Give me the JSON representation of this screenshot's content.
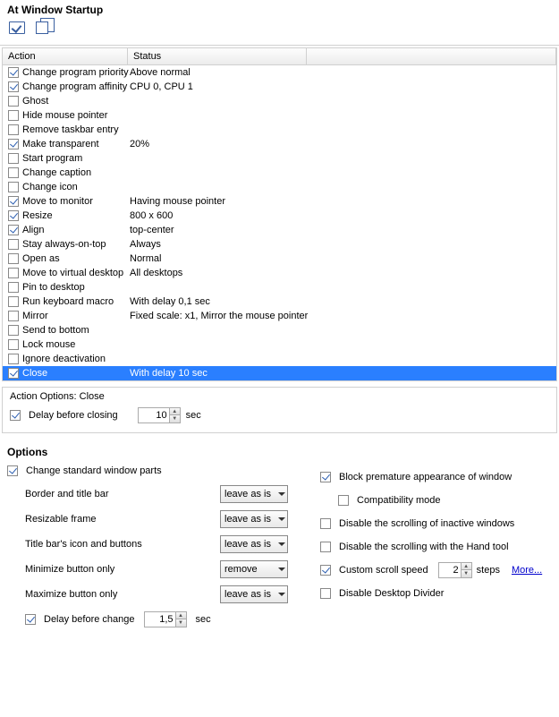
{
  "header": {
    "title": "At Window Startup"
  },
  "columns": {
    "action": "Action",
    "status": "Status"
  },
  "rows": [
    {
      "action": "Change program priority",
      "status": "Above normal",
      "checked": true
    },
    {
      "action": "Change program affinity",
      "status": "CPU 0, CPU 1",
      "checked": true
    },
    {
      "action": "Ghost",
      "status": "",
      "checked": false
    },
    {
      "action": "Hide mouse pointer",
      "status": "",
      "checked": false
    },
    {
      "action": "Remove taskbar entry",
      "status": "",
      "checked": false
    },
    {
      "action": "Make transparent",
      "status": "20%",
      "checked": true
    },
    {
      "action": "Start program",
      "status": "",
      "checked": false
    },
    {
      "action": "Change caption",
      "status": "",
      "checked": false
    },
    {
      "action": "Change icon",
      "status": "",
      "checked": false
    },
    {
      "action": "Move to monitor",
      "status": "Having mouse pointer",
      "checked": true
    },
    {
      "action": "Resize",
      "status": "800 x 600",
      "checked": true
    },
    {
      "action": "Align",
      "status": "top-center",
      "checked": true
    },
    {
      "action": "Stay always-on-top",
      "status": "Always",
      "checked": false
    },
    {
      "action": "Open as",
      "status": "Normal",
      "checked": false
    },
    {
      "action": "Move to virtual desktop",
      "status": "All desktops",
      "checked": false
    },
    {
      "action": "Pin to desktop",
      "status": "",
      "checked": false
    },
    {
      "action": "Run keyboard macro",
      "status": "With delay 0,1 sec",
      "checked": false
    },
    {
      "action": "Mirror",
      "status": "Fixed scale: x1, Mirror the mouse pointer",
      "checked": false
    },
    {
      "action": "Send to bottom",
      "status": "",
      "checked": false
    },
    {
      "action": "Lock mouse",
      "status": "",
      "checked": false
    },
    {
      "action": "Ignore deactivation",
      "status": "",
      "checked": false
    },
    {
      "action": "Close",
      "status": "With delay 10 sec",
      "checked": true,
      "selected": true
    }
  ],
  "action_options": {
    "title": "Action Options: Close",
    "delay_label": "Delay before closing",
    "delay_value": "10",
    "delay_unit": "sec"
  },
  "options": {
    "title": "Options",
    "change_parts": "Change standard window parts",
    "border_label": "Border and title bar",
    "border_val": "leave as is",
    "frame_label": "Resizable frame",
    "frame_val": "leave as is",
    "titlebar_label": "Title bar's icon and buttons",
    "titlebar_val": "leave as is",
    "min_label": "Minimize button only",
    "min_val": "remove",
    "max_label": "Maximize button only",
    "max_val": "leave as is",
    "delay_change_label": "Delay before change",
    "delay_change_val": "1,5",
    "delay_change_unit": "sec",
    "block_premature": "Block premature appearance of window",
    "compat_mode": "Compatibility mode",
    "disable_inactive": "Disable the scrolling of inactive windows",
    "disable_hand": "Disable the scrolling with the Hand tool",
    "custom_scroll": "Custom scroll speed",
    "custom_scroll_val": "2",
    "custom_scroll_unit": "steps",
    "more": "More...",
    "disable_divider": "Disable Desktop Divider"
  }
}
